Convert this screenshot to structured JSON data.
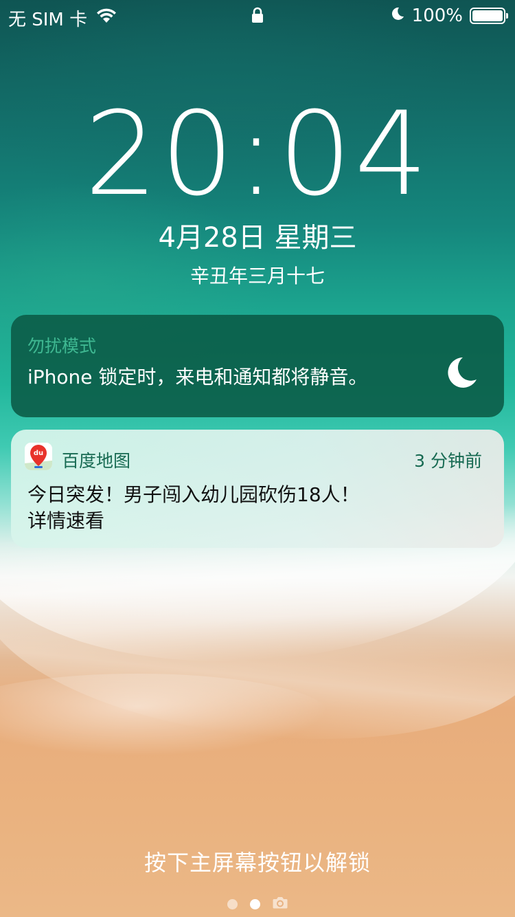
{
  "status_bar": {
    "carrier": "无 SIM 卡",
    "icons": [
      "wifi-icon",
      "lock-icon",
      "moon-icon",
      "battery-icon"
    ],
    "battery_percent": "100%",
    "battery_level": 1.0
  },
  "lock_screen": {
    "time": "20:04",
    "date": "4月28日 星期三",
    "lunar_date": "辛丑年三月十七",
    "unlock_hint": "按下主屏幕按钮以解锁",
    "page_indicator": {
      "pages": 2,
      "active": 2,
      "trailing_icon": "camera-icon"
    }
  },
  "dnd_banner": {
    "title": "勿扰模式",
    "message": "iPhone 锁定时，来电和通知都将静音。",
    "icon": "moon-icon"
  },
  "notification": {
    "app_name": "百度地图",
    "app_icon": "baidu-maps-icon",
    "app_icon_text": "du",
    "time": "3 分钟前",
    "body_line1": "今日突发！男子闯入幼儿园砍伤18人！",
    "body_line2": "详情速看"
  },
  "colors": {
    "dnd_title": "#3fb892",
    "notif_accent": "#176a52",
    "app_icon_red": "#e8322b"
  }
}
